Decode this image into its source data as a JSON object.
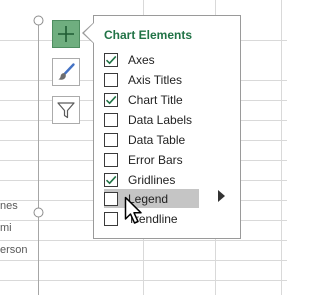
{
  "worksheet": {
    "row_label_fragments": [
      "nes",
      "mi",
      "erson"
    ]
  },
  "chart_buttons": [
    {
      "icon": "plus-icon",
      "active": true
    },
    {
      "icon": "paintbrush-icon",
      "active": false
    },
    {
      "icon": "filter-funnel-icon",
      "active": false
    }
  ],
  "panel": {
    "title": "Chart Elements",
    "items": [
      {
        "label": "Axes",
        "checked": true
      },
      {
        "label": "Axis Titles",
        "checked": false
      },
      {
        "label": "Chart Title",
        "checked": true
      },
      {
        "label": "Data Labels",
        "checked": false
      },
      {
        "label": "Data Table",
        "checked": false
      },
      {
        "label": "Error Bars",
        "checked": false
      },
      {
        "label": "Gridlines",
        "checked": true
      },
      {
        "label": "Legend",
        "checked": false,
        "hovered": true,
        "has_submenu": true
      },
      {
        "label": "Trendline",
        "checked": false
      }
    ]
  },
  "colors": {
    "accent_green": "#217346",
    "plus_button_bg": "#6fae7f",
    "check_green": "#217346",
    "hover_gray": "#c5c5c5",
    "gridline": "#d9d9d9"
  }
}
